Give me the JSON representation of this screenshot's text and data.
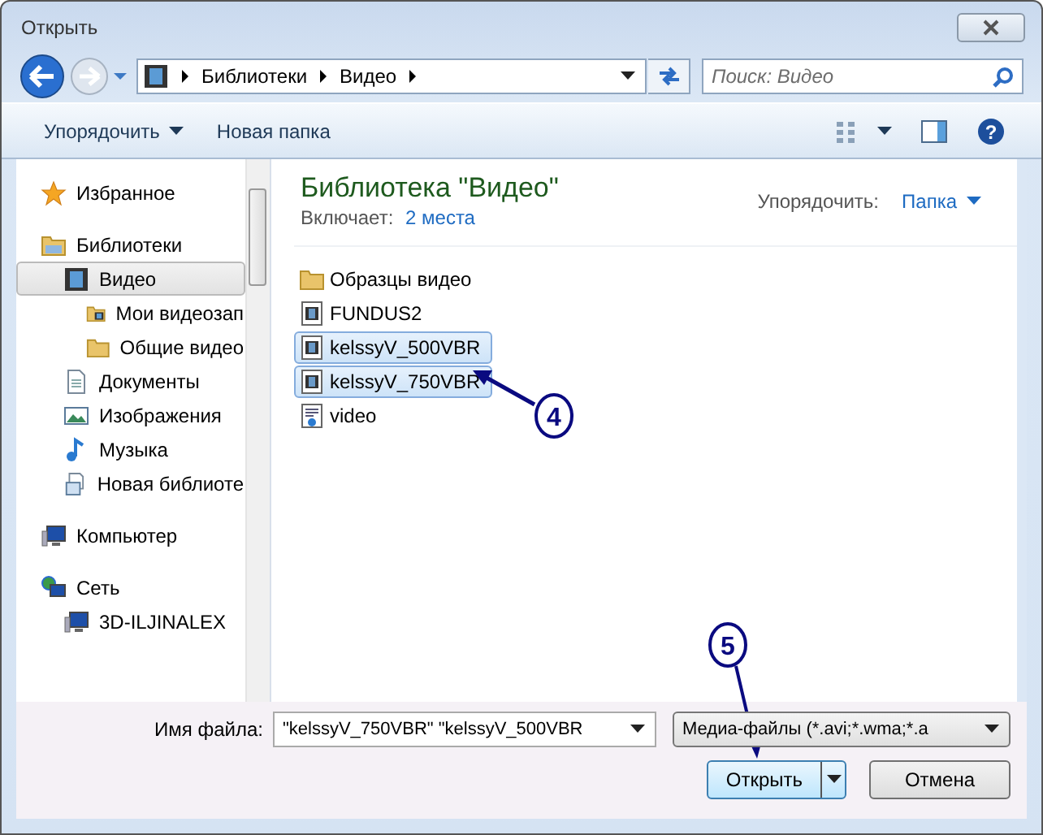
{
  "window": {
    "title": "Открыть"
  },
  "address": {
    "crumbs": [
      "Библиотеки",
      "Видео"
    ]
  },
  "search": {
    "placeholder": "Поиск: Видео"
  },
  "toolbar": {
    "organize": "Упорядочить",
    "new_folder": "Новая папка",
    "help": "?"
  },
  "sidebar": {
    "items": [
      {
        "label": "Избранное",
        "kind": "star",
        "selected": false
      },
      {
        "label": "Библиотеки",
        "kind": "library",
        "selected": false,
        "children": [
          {
            "label": "Видео",
            "kind": "video",
            "selected": true,
            "children": [
              {
                "label": "Мои видеозап",
                "kind": "folder-video",
                "selected": false
              },
              {
                "label": "Общие видео",
                "kind": "folder",
                "selected": false
              }
            ]
          },
          {
            "label": "Документы",
            "kind": "document",
            "selected": false
          },
          {
            "label": "Изображения",
            "kind": "image",
            "selected": false
          },
          {
            "label": "Музыка",
            "kind": "music",
            "selected": false
          },
          {
            "label": "Новая библиоте",
            "kind": "library-new",
            "selected": false
          }
        ]
      },
      {
        "label": "Компьютер",
        "kind": "computer",
        "selected": false
      },
      {
        "label": "Сеть",
        "kind": "network",
        "selected": false,
        "children": [
          {
            "label": "3D-ILJINALEX",
            "kind": "computer",
            "selected": false
          }
        ]
      }
    ]
  },
  "library": {
    "title": "Библиотека \"Видео\"",
    "includes_label": "Включает:",
    "includes_link": "2 места",
    "arrange_label": "Упорядочить:",
    "arrange_value": "Папка"
  },
  "files": [
    {
      "name": "Образцы видео",
      "kind": "folder",
      "selected": false
    },
    {
      "name": "FUNDUS2",
      "kind": "video",
      "selected": false
    },
    {
      "name": "kelssyV_500VBR",
      "kind": "video",
      "selected": true
    },
    {
      "name": "kelssyV_750VBR",
      "kind": "video",
      "selected": true
    },
    {
      "name": "video",
      "kind": "playlist",
      "selected": false
    }
  ],
  "footer": {
    "filename_label": "Имя файла:",
    "filename_value": "\"kelssyV_750VBR\" \"kelssyV_500VBR",
    "filter": "Медиа-файлы (*.avi;*.wma;*.a",
    "open": "Открыть",
    "cancel": "Отмена"
  },
  "callouts": [
    {
      "label": "4"
    },
    {
      "label": "5"
    }
  ]
}
